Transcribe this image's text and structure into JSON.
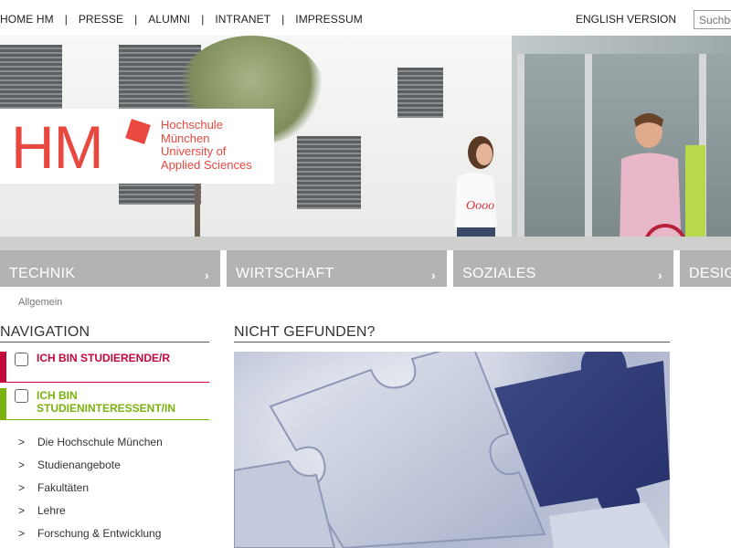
{
  "topnav": {
    "items": [
      "HOME HM",
      "PRESSE",
      "ALUMNI",
      "INTRANET",
      "IMPRESSUM"
    ],
    "separator": "|",
    "english_label": "ENGLISH VERSION",
    "search_placeholder": "Suchbegriff"
  },
  "logo": {
    "letters": "HM",
    "line1": "Hochschule",
    "line2": "München",
    "line3": "University of",
    "line4": "Applied Sciences",
    "brand_color": "#e8483f"
  },
  "faculty_tabs": [
    {
      "label": "TECHNIK",
      "chevron": "›"
    },
    {
      "label": "WIRTSCHAFT",
      "chevron": "›"
    },
    {
      "label": "SOZIALES",
      "chevron": "›"
    },
    {
      "label": "DESIGN",
      "chevron": "›"
    }
  ],
  "breadcrumb": "Allgemein",
  "navigation": {
    "title": "NAVIGATION",
    "roles": [
      {
        "label": "ICH BIN STUDIERENDE/R",
        "color": "#c6093b",
        "checked": false
      },
      {
        "label": "ICH BIN STUDIENINTERESSENT/IN",
        "color": "#7ab20f",
        "checked": false
      }
    ],
    "arrow": ">",
    "items": [
      "Die Hochschule München",
      "Studienangebote",
      "Fakultäten",
      "Lehre",
      "Forschung & Entwicklung"
    ]
  },
  "main": {
    "title": "NICHT GEFUNDEN?"
  }
}
